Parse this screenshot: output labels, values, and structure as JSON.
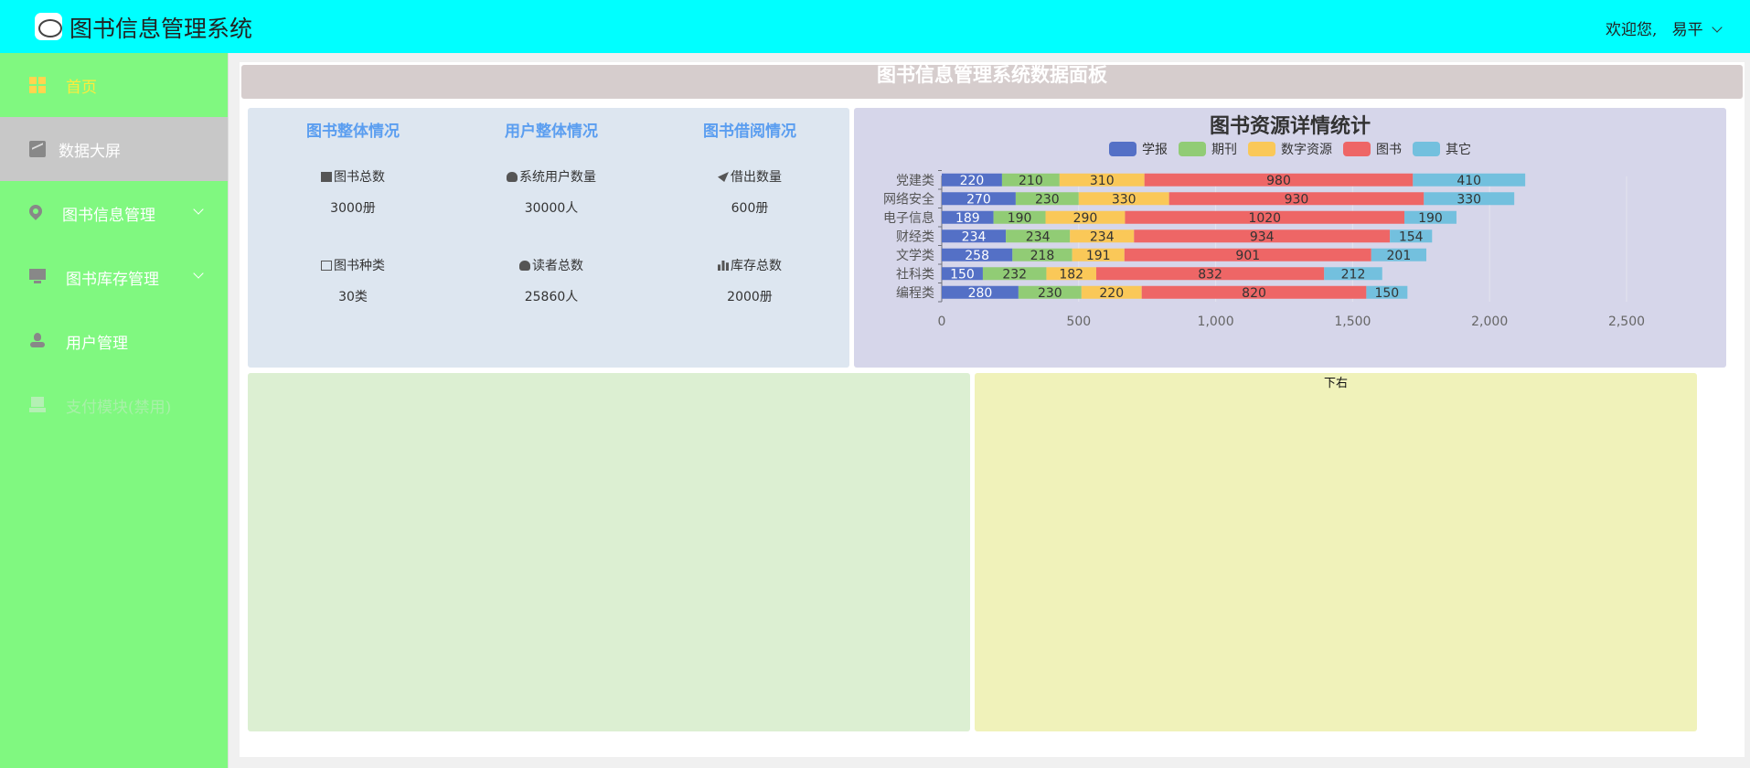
{
  "header": {
    "app_title": "图书信息管理系统",
    "welcome": "欢迎您,",
    "username": "易平"
  },
  "sidebar": {
    "items": [
      {
        "label": "首页",
        "icon": "grid-icon"
      },
      {
        "label": "数据大屏",
        "icon": "chart-line-icon"
      },
      {
        "label": "图书信息管理",
        "icon": "location-pin-icon"
      },
      {
        "label": "图书库存管理",
        "icon": "monitor-icon"
      },
      {
        "label": "用户管理",
        "icon": "user-icon"
      },
      {
        "label": "支付模块(禁用)",
        "icon": "payment-icon"
      }
    ]
  },
  "dashboard": {
    "title": "图书信息管理系统数据面板"
  },
  "stats": {
    "books": {
      "heading": "图书整体情况",
      "total_label": "图书总数",
      "total_value": "3000册",
      "kinds_label": "图书种类",
      "kinds_value": "30类"
    },
    "users": {
      "heading": "用户整体情况",
      "system_users_label": "系统用户数量",
      "system_users_value": "30000人",
      "readers_label": "读者总数",
      "readers_value": "25860人"
    },
    "borrow": {
      "heading": "图书借阅情况",
      "lent_label": "借出数量",
      "lent_value": "600册",
      "stock_label": "库存总数",
      "stock_value": "2000册"
    }
  },
  "bottom_right": {
    "label": "下右"
  },
  "colors": {
    "header_bg": "#00ffff",
    "sidebar_bg": "#80f880",
    "accent_blue": "#5b9ef0"
  },
  "chart_data": {
    "type": "bar",
    "orientation": "horizontal",
    "stacked": true,
    "title": "图书资源详情统计",
    "categories": [
      "编程类",
      "社科类",
      "文学类",
      "财经类",
      "电子信息",
      "网络安全",
      "党建类"
    ],
    "series": [
      {
        "name": "学报",
        "color": "#5470c6",
        "values": [
          280,
          150,
          258,
          234,
          189,
          270,
          220
        ]
      },
      {
        "name": "期刊",
        "color": "#91cc75",
        "values": [
          230,
          232,
          218,
          234,
          190,
          230,
          210
        ]
      },
      {
        "name": "数字资源",
        "color": "#fac858",
        "values": [
          220,
          182,
          191,
          234,
          290,
          330,
          310
        ]
      },
      {
        "name": "图书",
        "color": "#ee6666",
        "values": [
          820,
          832,
          901,
          934,
          1020,
          930,
          980
        ]
      },
      {
        "name": "其它",
        "color": "#73c0de",
        "values": [
          150,
          212,
          201,
          154,
          190,
          330,
          410
        ]
      }
    ],
    "x_ticks": [
      "0",
      "500",
      "1,000",
      "1,500",
      "2,000",
      "2,500"
    ],
    "xlim": [
      0,
      2500
    ],
    "legend": "top-center",
    "grid": true
  }
}
